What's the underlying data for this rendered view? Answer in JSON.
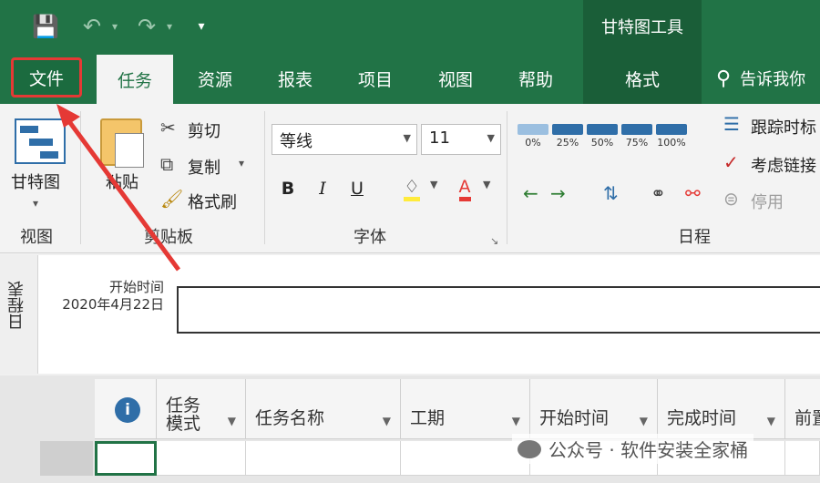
{
  "context_title": "甘特图工具",
  "tabs": {
    "file": "文件",
    "task": "任务",
    "resource": "资源",
    "report": "报表",
    "project": "项目",
    "view": "视图",
    "help": "帮助",
    "format": "格式"
  },
  "tell_me": "告诉我你",
  "ribbon": {
    "view_group": {
      "gantt_label": "甘特图",
      "group_label": "视图"
    },
    "clipboard_group": {
      "paste": "粘贴",
      "cut": "剪切",
      "copy": "复制",
      "format_painter": "格式刷",
      "group_label": "剪贴板"
    },
    "font_group": {
      "font_name": "等线",
      "font_size": "11",
      "bold": "B",
      "italic": "I",
      "underline": "U",
      "group_label": "字体"
    },
    "schedule_group": {
      "percents": [
        "0%",
        "25%",
        "50%",
        "75%",
        "100%"
      ],
      "track": "跟踪时标",
      "respect_links": "考虑链接",
      "inactivate": "停用",
      "group_label": "日程"
    }
  },
  "timeline": {
    "vertical_label": "日程表",
    "start_title": "开始时间",
    "start_date": "2020年4月22日"
  },
  "grid": {
    "columns": [
      "任务\n模式",
      "任务名称",
      "工期",
      "开始时间",
      "完成时间",
      "前置"
    ]
  },
  "watermark": "公众号 · 软件安装全家桶",
  "colors": {
    "accent": "#217346",
    "highlight": "#e53935"
  }
}
